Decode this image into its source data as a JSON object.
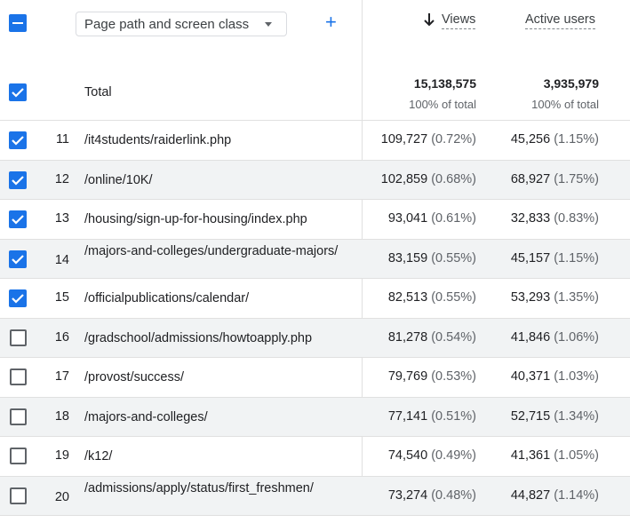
{
  "header": {
    "dimension_label": "Page path and screen class",
    "add_icon": "plus-icon",
    "columns": [
      {
        "label": "Views",
        "sorted": "descending"
      },
      {
        "label": "Active users"
      }
    ]
  },
  "total": {
    "label": "Total",
    "views": "15,138,575",
    "views_sub": "100% of total",
    "users": "3,935,979",
    "users_sub": "100% of total",
    "checked": true
  },
  "rows": [
    {
      "index": "11",
      "path": "/it4students/raiderlink.php",
      "views": "109,727",
      "views_pct": "(0.72%)",
      "users": "45,256",
      "users_pct": "(1.15%)",
      "checked": true
    },
    {
      "index": "12",
      "path": "/online/10K/",
      "views": "102,859",
      "views_pct": "(0.68%)",
      "users": "68,927",
      "users_pct": "(1.75%)",
      "checked": true
    },
    {
      "index": "13",
      "path": "/housing/sign-up-for-housing/index.php",
      "views": "93,041",
      "views_pct": "(0.61%)",
      "users": "32,833",
      "users_pct": "(0.83%)",
      "checked": true
    },
    {
      "index": "14",
      "path": "/majors-and-colleges/undergraduate-majors/",
      "views": "83,159",
      "views_pct": "(0.55%)",
      "users": "45,157",
      "users_pct": "(1.15%)",
      "checked": true
    },
    {
      "index": "15",
      "path": "/officialpublications/calendar/",
      "views": "82,513",
      "views_pct": "(0.55%)",
      "users": "53,293",
      "users_pct": "(1.35%)",
      "checked": true
    },
    {
      "index": "16",
      "path": "/gradschool/admissions/howtoapply.php",
      "views": "81,278",
      "views_pct": "(0.54%)",
      "users": "41,846",
      "users_pct": "(1.06%)",
      "checked": false
    },
    {
      "index": "17",
      "path": "/provost/success/",
      "views": "79,769",
      "views_pct": "(0.53%)",
      "users": "40,371",
      "users_pct": "(1.03%)",
      "checked": false
    },
    {
      "index": "18",
      "path": "/majors-and-colleges/",
      "views": "77,141",
      "views_pct": "(0.51%)",
      "users": "52,715",
      "users_pct": "(1.34%)",
      "checked": false
    },
    {
      "index": "19",
      "path": "/k12/",
      "views": "74,540",
      "views_pct": "(0.49%)",
      "users": "41,361",
      "users_pct": "(1.05%)",
      "checked": false
    },
    {
      "index": "20",
      "path": "/admissions/apply/status/first_freshmen/",
      "views": "73,274",
      "views_pct": "(0.48%)",
      "users": "44,827",
      "users_pct": "(1.14%)",
      "checked": false
    }
  ],
  "colors": {
    "accent": "#1a73e8",
    "row_shade": "#f1f3f4",
    "divider": "#e0e0e0"
  }
}
